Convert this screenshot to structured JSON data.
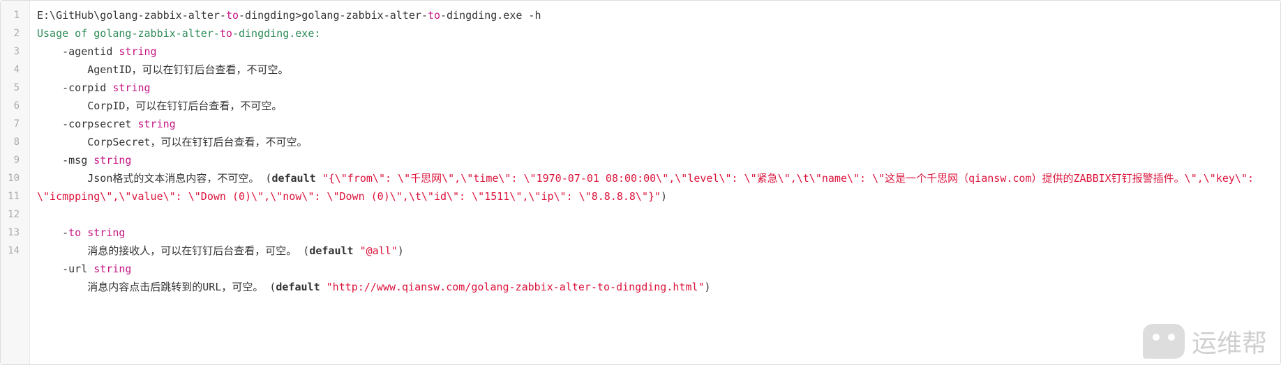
{
  "gutter": [
    "1",
    "2",
    "3",
    "4",
    "5",
    "6",
    "7",
    "8",
    "9",
    "10",
    "",
    "",
    "11",
    "12",
    "13",
    "14"
  ],
  "lines": {
    "l1": {
      "path": "E:\\GitHub\\golang-zabbix-alter-",
      "to1": "to",
      "mid1": "-dingding>golang-zabbix-alter-",
      "to2": "to",
      "mid2": "-dingding.exe -h"
    },
    "l2": {
      "usage": "Usage of golang-zabbix-alter-",
      "to": "to",
      "rest": "-dingding.exe:"
    },
    "l3": {
      "flag": "    -agentid ",
      "type": "string"
    },
    "l4": {
      "desc": "        AgentID，可以在钉钉后台查看，不可空。"
    },
    "l5": {
      "flag": "    -corpid ",
      "type": "string"
    },
    "l6": {
      "desc": "        CorpID，可以在钉钉后台查看，不可空。"
    },
    "l7": {
      "flag": "    -corpsecret ",
      "type": "string"
    },
    "l8": {
      "desc": "        CorpSecret，可以在钉钉后台查看，不可空。"
    },
    "l9": {
      "flag": "    -msg ",
      "type": "string"
    },
    "l10": {
      "desc": "        Json格式的文本消息内容，不可空。 (",
      "default": "default",
      "space": " ",
      "str": "\"{\\\"from\\\": \\\"千思网\\\",\\\"time\\\": \\\"1970-07-01 08:00:00\\\",\\\"level\\\": \\\"紧急\\\",\\t\\\"name\\\": \\\"这是一个千思网（qiansw.com）提供的ZABBIX钉钉报警插件。\\\",\\\"key\\\": \\\"icmpping\\\",\\\"value\\\": \\\"Down (0)\\\",\\\"now\\\": \\\"Down (0)\\\",\\t\\\"id\\\": \\\"1511\\\",\\\"ip\\\": \\\"8.8.8.8\\\"}\"",
      "close": ")"
    },
    "l11": {
      "flag": "    -",
      "to": "to",
      "space": " ",
      "type": "string"
    },
    "l12": {
      "desc": "        消息的接收人，可以在钉钉后台查看，可空。 (",
      "default": "default",
      "space": " ",
      "str": "\"@all\"",
      "close": ")"
    },
    "l13": {
      "flag": "    -url ",
      "type": "string"
    },
    "l14": {
      "desc": "        消息内容点击后跳转到的URL，可空。 (",
      "default": "default",
      "space": " ",
      "str": "\"http://www.qiansw.com/golang-zabbix-alter-to-dingding.html\"",
      "close": ")"
    }
  },
  "watermark": "运维帮"
}
